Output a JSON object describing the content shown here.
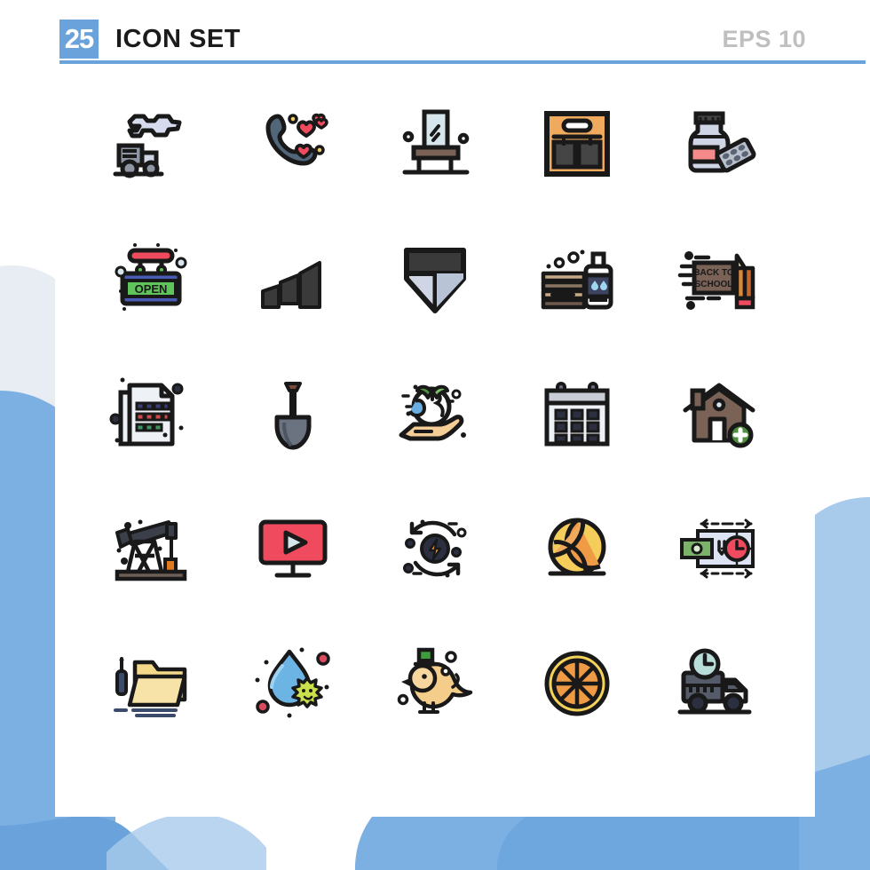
{
  "header": {
    "count_badge": "25",
    "title": "ICON SET",
    "eps_label": "EPS 10",
    "badge_color": "#6aa3dc",
    "rule_color": "#6aa3dc",
    "title_color": "#1b1b1b",
    "eps_color": "#bfbfbf"
  },
  "background": {
    "page_color": "#ffffff",
    "card_color": "#ffffff",
    "blob_light": "#e7edf2",
    "blob_mid": "#a8caeb",
    "blob_blue": "#7cb0e2",
    "blob_deep": "#6aa3dc"
  },
  "palette": {
    "outline": "#191919",
    "light_gray": "#cfd5e5",
    "pale_blue": "#d6e6ec",
    "dark_gray": "#5a6475",
    "red": "#ef4a5d",
    "pink": "#f58a8a",
    "green": "#5fc45a",
    "blue": "#4a5bb5",
    "orange": "#f0aa5e",
    "yellow": "#f5cd6b",
    "brown": "#7a6257",
    "tan": "#f5cd96",
    "charcoal": "#333333"
  },
  "grid": {
    "columns": 5,
    "rows": 5,
    "total": 25
  },
  "icons": [
    {
      "index": 1,
      "name": "truck-pollution-icon",
      "label": "Truck Pollution",
      "row": 1,
      "col": 1
    },
    {
      "index": 2,
      "name": "love-call-icon",
      "label": "Love Call",
      "row": 1,
      "col": 2
    },
    {
      "index": 3,
      "name": "dressing-table-icon",
      "label": "Dressing Table",
      "row": 1,
      "col": 3
    },
    {
      "index": 4,
      "name": "tool-bag-icon",
      "label": "Tool Bag",
      "row": 1,
      "col": 4
    },
    {
      "index": 5,
      "name": "medicine-bottle-icon",
      "label": "Medicine Bottle",
      "row": 1,
      "col": 5
    },
    {
      "index": 6,
      "name": "open-sign-icon",
      "label": "Open Sign",
      "row": 2,
      "col": 1,
      "text": "OPEN"
    },
    {
      "index": 7,
      "name": "signal-bars-icon",
      "label": "Signal Bars",
      "row": 2,
      "col": 2
    },
    {
      "index": 8,
      "name": "shield-badge-icon",
      "label": "Shield Badge",
      "row": 2,
      "col": 3
    },
    {
      "index": 9,
      "name": "laundry-detergent-icon",
      "label": "Laundry Detergent",
      "row": 2,
      "col": 4
    },
    {
      "index": 10,
      "name": "back-to-school-icon",
      "label": "Back To School",
      "row": 2,
      "col": 5,
      "text_line1": "BACK TO",
      "text_line2": "SCHOOL"
    },
    {
      "index": 11,
      "name": "documents-icon",
      "label": "Documents",
      "row": 3,
      "col": 1
    },
    {
      "index": 12,
      "name": "shovel-icon",
      "label": "Shovel",
      "row": 3,
      "col": 2
    },
    {
      "index": 13,
      "name": "eco-earth-hand-icon",
      "label": "Eco Earth In Hand",
      "row": 3,
      "col": 3
    },
    {
      "index": 14,
      "name": "calendar-icon",
      "label": "Calendar",
      "row": 3,
      "col": 4
    },
    {
      "index": 15,
      "name": "add-home-icon",
      "label": "Add Home",
      "row": 3,
      "col": 5
    },
    {
      "index": 16,
      "name": "oil-pump-icon",
      "label": "Oil Pump",
      "row": 4,
      "col": 1
    },
    {
      "index": 17,
      "name": "video-player-icon",
      "label": "Video Player",
      "row": 4,
      "col": 2
    },
    {
      "index": 18,
      "name": "renewable-energy-icon",
      "label": "Renewable Energy",
      "row": 4,
      "col": 3
    },
    {
      "index": 19,
      "name": "volleyball-icon",
      "label": "Volleyball",
      "row": 4,
      "col": 4
    },
    {
      "index": 20,
      "name": "time-is-money-icon",
      "label": "Time Is Money",
      "row": 4,
      "col": 5
    },
    {
      "index": 21,
      "name": "folder-settings-icon",
      "label": "Folder Settings",
      "row": 5,
      "col": 1
    },
    {
      "index": 22,
      "name": "water-contamination-icon",
      "label": "Water Contamination",
      "row": 5,
      "col": 2
    },
    {
      "index": 23,
      "name": "bird-hat-icon",
      "label": "Bird With Hat",
      "row": 5,
      "col": 3
    },
    {
      "index": 24,
      "name": "orange-slice-icon",
      "label": "Orange Slice",
      "row": 5,
      "col": 4
    },
    {
      "index": 25,
      "name": "delivery-time-truck-icon",
      "label": "Delivery Time Truck",
      "row": 5,
      "col": 5
    }
  ]
}
